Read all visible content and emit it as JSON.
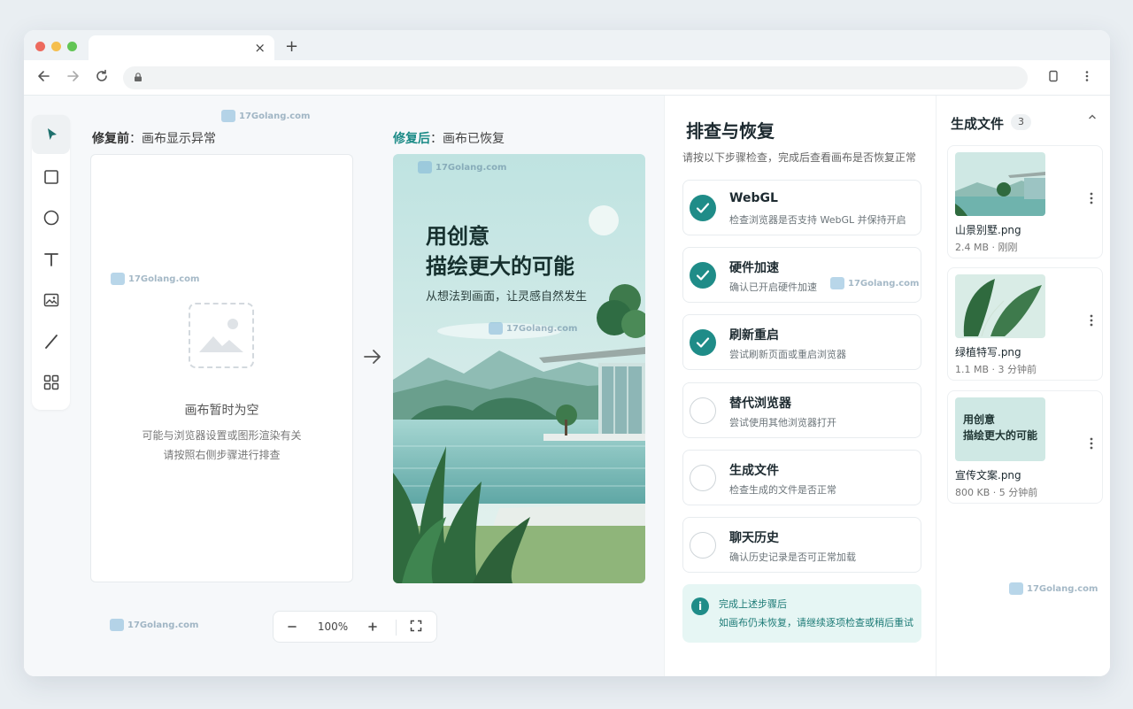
{
  "watermark": {
    "text": "17Golang.com"
  },
  "browser": {
    "tab_close": "×",
    "new_tab": "+"
  },
  "canvas": {
    "before_label": "修复前",
    "before_sub": "：画布显示异常",
    "after_label": "修复后",
    "after_sub": "：画布已恢复",
    "empty_title": "画布暂时为空",
    "empty_desc_line1": "可能与浏览器设置或图形渲染有关",
    "empty_desc_line2": "请按照右侧步骤进行排查",
    "poster_line1": "用创意",
    "poster_line2": "描绘更大的可能",
    "poster_sub": "从想法到画面，让灵感自然发生",
    "zoom": "100%"
  },
  "troubleshoot": {
    "title": "排查与恢复",
    "desc": "请按以下步骤检查，完成后查看画布是否恢复正常",
    "steps": [
      {
        "title": "WebGL",
        "desc": "检查浏览器是否支持 WebGL 并保持开启",
        "done": true
      },
      {
        "title": "硬件加速",
        "desc": "确认已开启硬件加速",
        "done": true
      },
      {
        "title": "刷新重启",
        "desc": "尝试刷新页面或重启浏览器",
        "done": true
      },
      {
        "title": "替代浏览器",
        "desc": "尝试使用其他浏览器打开",
        "done": false
      },
      {
        "title": "生成文件",
        "desc": "检查生成的文件是否正常",
        "done": false
      },
      {
        "title": "聊天历史",
        "desc": "确认历史记录是否可正常加载",
        "done": false
      }
    ],
    "notice_title": "完成上述步骤后",
    "notice_desc": "如画布仍未恢复，请继续逐项检查或稍后重试"
  },
  "files": {
    "title": "生成文件",
    "count": "3",
    "items": [
      {
        "name": "山景别墅.png",
        "meta": "2.4 MB · 刚刚"
      },
      {
        "name": "绿植特写.png",
        "meta": "1.1 MB · 3 分钟前"
      },
      {
        "name": "宣传文案.png",
        "meta": "800 KB · 5 分钟前",
        "thumb_line1": "用创意",
        "thumb_line2": "描绘更大的可能"
      }
    ]
  },
  "colors": {
    "accent": "#1f8c88",
    "notice_bg": "#e6f6f4",
    "page_bg": "#e9eef2"
  },
  "icons": [
    "back-icon",
    "forward-icon",
    "reload-icon",
    "lock-icon",
    "bookmark-icon",
    "menu-icon",
    "select-icon",
    "rectangle-icon",
    "circle-icon",
    "text-icon",
    "image-icon",
    "line-icon",
    "grid-icon",
    "arrow-right-icon",
    "info-icon",
    "chevron-up-icon",
    "more-icon",
    "fullscreen-icon"
  ]
}
